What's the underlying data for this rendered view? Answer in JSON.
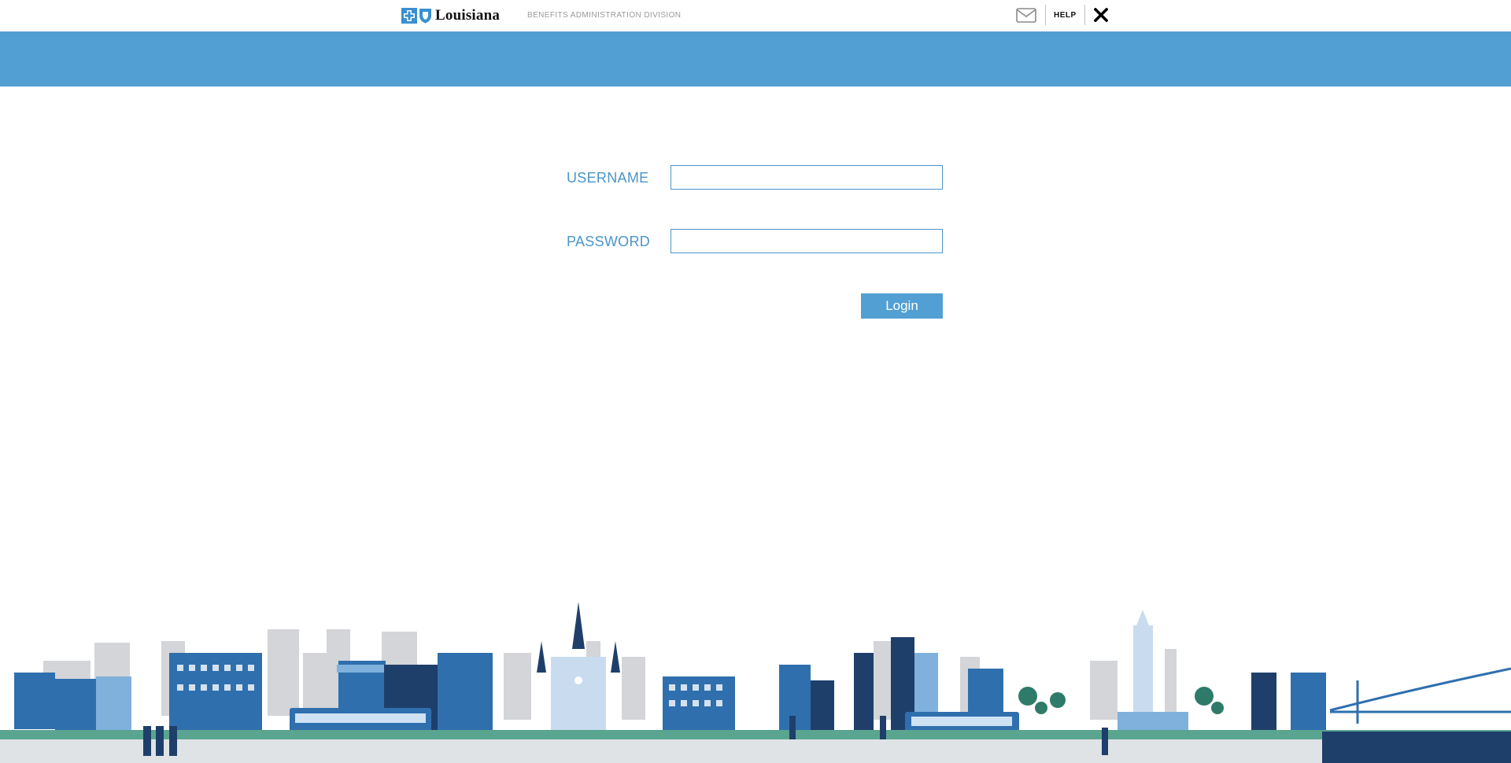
{
  "header": {
    "brand": "Louisiana",
    "division": "BENEFITS ADMINISTRATION DIVISION",
    "help_label": "HELP",
    "icons": [
      "cross-shield-logo-icon",
      "mail-icon",
      "close-icon"
    ]
  },
  "login": {
    "username_label": "USERNAME",
    "username_value": "",
    "password_label": "PASSWORD",
    "password_value": "",
    "login_button": "Login"
  },
  "colors": {
    "accent": "#529fd3",
    "label": "#4b95c8",
    "skyline_dark": "#1f3f6b",
    "skyline_mid": "#2f6fae",
    "skyline_light": "#cfd2d6",
    "ground_green": "#5aa58f"
  }
}
